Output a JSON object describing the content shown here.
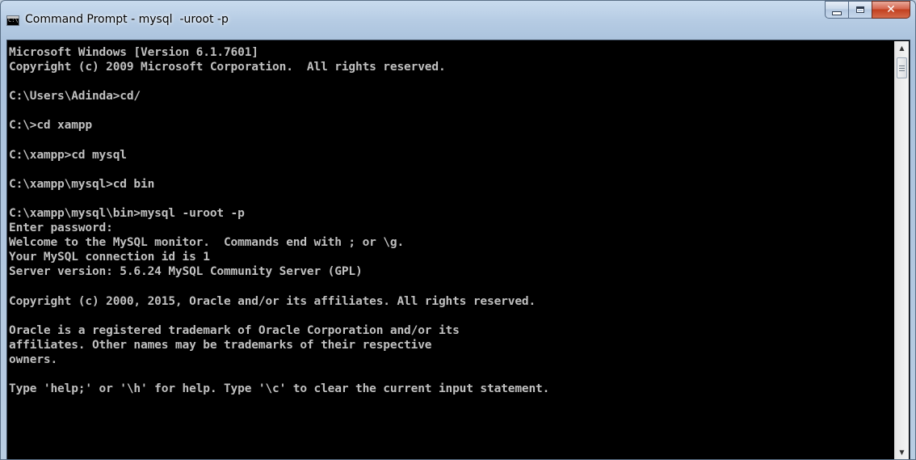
{
  "window": {
    "title": "Command Prompt - mysql  -uroot -p",
    "icon": "cmd-app-icon",
    "icon_text": "C:\\",
    "colors": {
      "console_background": "#000000",
      "console_text": "#c0c0c0",
      "titlebar": "#b9cee6",
      "close_button": "#c9472a"
    }
  },
  "caption_buttons": {
    "minimize": "minimize-icon",
    "maximize": "maximize-icon",
    "close": "close-icon",
    "close_glyph": "✕"
  },
  "console": {
    "lines": [
      "Microsoft Windows [Version 6.1.7601]",
      "Copyright (c) 2009 Microsoft Corporation.  All rights reserved.",
      "",
      "C:\\Users\\Adinda>cd/",
      "",
      "C:\\>cd xampp",
      "",
      "C:\\xampp>cd mysql",
      "",
      "C:\\xampp\\mysql>cd bin",
      "",
      "C:\\xampp\\mysql\\bin>mysql -uroot -p",
      "Enter password:",
      "Welcome to the MySQL monitor.  Commands end with ; or \\g.",
      "Your MySQL connection id is 1",
      "Server version: 5.6.24 MySQL Community Server (GPL)",
      "",
      "Copyright (c) 2000, 2015, Oracle and/or its affiliates. All rights reserved.",
      "",
      "Oracle is a registered trademark of Oracle Corporation and/or its",
      "affiliates. Other names may be trademarks of their respective",
      "owners.",
      "",
      "Type 'help;' or '\\h' for help. Type '\\c' to clear the current input statement."
    ]
  },
  "scrollbar": {
    "up_arrow": "▲",
    "down_arrow": "▼",
    "position": 0
  }
}
